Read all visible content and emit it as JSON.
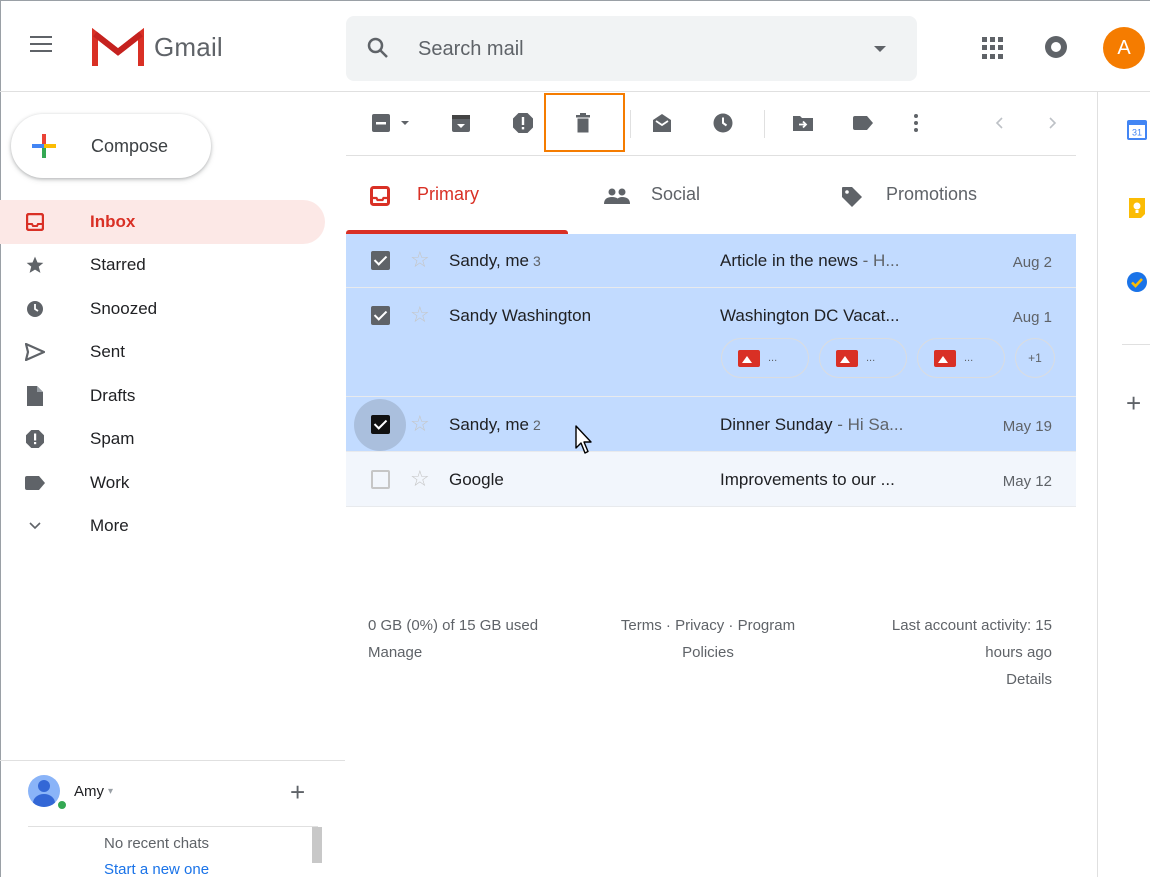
{
  "header": {
    "app_name": "Gmail",
    "search_placeholder": "Search mail",
    "avatar_letter": "A"
  },
  "compose_label": "Compose",
  "sidebar": {
    "items": [
      {
        "label": "Inbox",
        "icon": "inbox-icon",
        "active": true
      },
      {
        "label": "Starred",
        "icon": "star-icon"
      },
      {
        "label": "Snoozed",
        "icon": "clock-icon"
      },
      {
        "label": "Sent",
        "icon": "send-icon"
      },
      {
        "label": "Drafts",
        "icon": "draft-icon"
      },
      {
        "label": "Spam",
        "icon": "spam-icon"
      },
      {
        "label": "Work",
        "icon": "label-icon"
      },
      {
        "label": "More",
        "icon": "chevron-down-icon"
      }
    ]
  },
  "chat": {
    "user": "Amy",
    "caret": "▾",
    "no_recent": "No recent chats",
    "start_new": "Start a new one"
  },
  "toolbar": {
    "icons": [
      "select-checkbox-icon",
      "select-dropdown-icon",
      "archive-icon",
      "report-spam-icon",
      "trash-icon",
      "mark-unread-icon",
      "snooze-icon",
      "move-to-icon",
      "label-icon",
      "more-vert-icon",
      "chevron-left-icon",
      "chevron-right-icon"
    ]
  },
  "tabs": [
    {
      "label": "Primary",
      "icon": "inbox-icon",
      "active": true
    },
    {
      "label": "Social",
      "icon": "people-icon"
    },
    {
      "label": "Promotions",
      "icon": "tag-icon"
    }
  ],
  "emails": [
    {
      "sender": "Sandy, me",
      "count": "3",
      "subject": "Article in the news",
      "snippet": " - H...",
      "date": "Aug 2",
      "selected": true
    },
    {
      "sender": "Sandy Washington",
      "count": "",
      "subject": "Washington DC Vacat...",
      "snippet": "",
      "date": "Aug 1",
      "selected": true,
      "attachments": [
        "...",
        "...",
        "..."
      ],
      "more_attachments": "+1"
    },
    {
      "sender": "Sandy, me",
      "count": "2",
      "subject": "Dinner Sunday",
      "snippet": " - Hi Sa...",
      "date": "May 19",
      "selected": true
    },
    {
      "sender": "Google",
      "count": "",
      "subject": "Improvements to our ...",
      "snippet": "",
      "date": "May 12",
      "selected": false
    }
  ],
  "footer": {
    "storage": "0 GB (0%) of 15 GB used",
    "manage": "Manage",
    "terms_line1": "Terms · Privacy · Program",
    "terms_line2": "Policies",
    "activity_line1": "Last account activity: 15",
    "activity_line2": "hours ago",
    "details": "Details"
  },
  "side_panel": {
    "calendar_day": "31"
  },
  "colors": {
    "accent_red": "#d93025",
    "selected_row": "#c2dbff",
    "highlight_box": "#f57c00",
    "avatar": "#f57c00"
  }
}
